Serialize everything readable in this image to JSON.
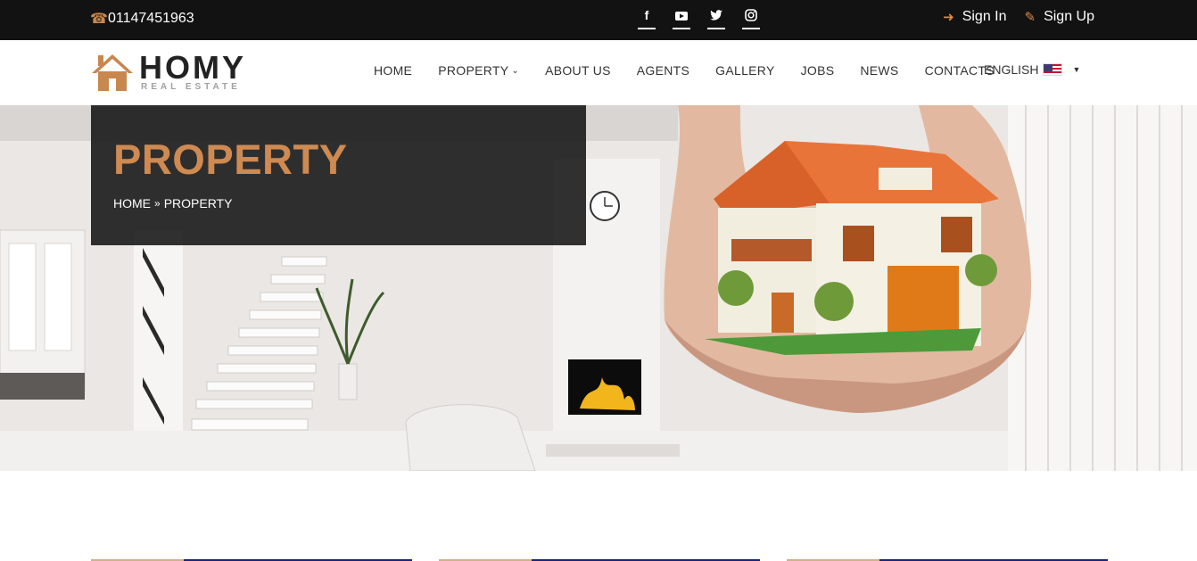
{
  "topbar": {
    "phone": "01147451963",
    "social": [
      "facebook-icon",
      "youtube-icon",
      "twitter-icon",
      "instagram-icon"
    ],
    "sign_in": "Sign In",
    "sign_up": "Sign Up"
  },
  "header": {
    "brand": "HOMY",
    "tagline": "REAL ESTATE",
    "nav": [
      "HOME",
      "PROPERTY",
      "ABOUT US",
      "AGENTS",
      "GALLERY",
      "JOBS",
      "NEWS",
      "CONTACTS"
    ],
    "language": "ENGLISH"
  },
  "hero": {
    "title": "PROPERTY",
    "breadcrumb": [
      "HOME",
      "PROPERTY"
    ]
  },
  "colors": {
    "accent": "#cf8a52",
    "topbar_bg": "#121212",
    "card_line_dark": "#1a237e"
  }
}
